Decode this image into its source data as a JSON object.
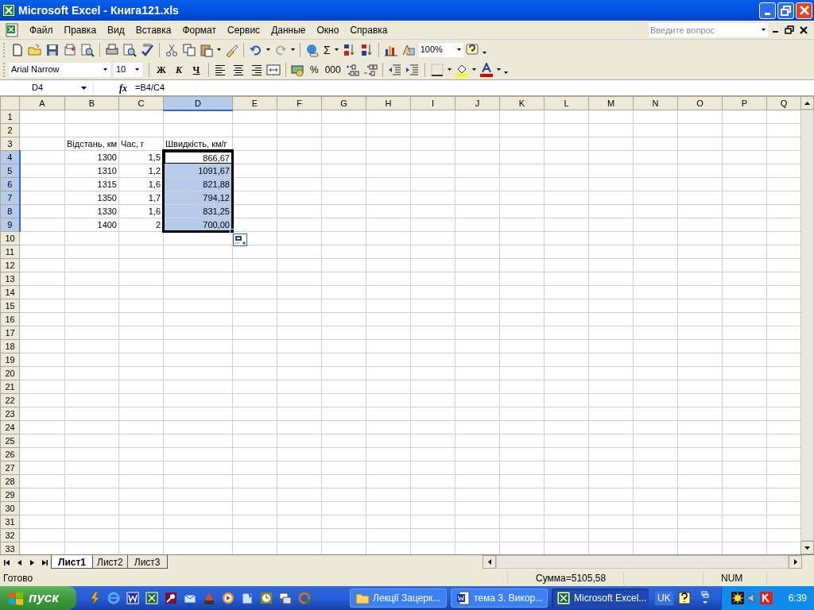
{
  "window": {
    "title": "Microsoft Excel - Книга121.xls"
  },
  "menu": [
    {
      "label": "Файл"
    },
    {
      "label": "Правка"
    },
    {
      "label": "Вид"
    },
    {
      "label": "Вставка"
    },
    {
      "label": "Формат"
    },
    {
      "label": "Сервис"
    },
    {
      "label": "Данные"
    },
    {
      "label": "Окно"
    },
    {
      "label": "Справка"
    }
  ],
  "help_box": {
    "placeholder": "Введите вопрос"
  },
  "standard_toolbar": {
    "autosum": "Σ",
    "zoom": "100%"
  },
  "formatting_toolbar": {
    "font": "Arial Narrow",
    "size": "10",
    "style_buttons": [
      "Ж",
      "К",
      "Ч"
    ],
    "number_buttons": [
      "%",
      "000"
    ]
  },
  "formula_bar": {
    "name_box": "D4",
    "function_label": "fx",
    "formula": "=B4/C4"
  },
  "columns": [
    {
      "label": "A",
      "selected": false
    },
    {
      "label": "B",
      "selected": false
    },
    {
      "label": "C",
      "selected": false
    },
    {
      "label": "D",
      "selected": true
    },
    {
      "label": "E",
      "selected": false
    },
    {
      "label": "F",
      "selected": false
    },
    {
      "label": "G",
      "selected": false
    },
    {
      "label": "H",
      "selected": false
    },
    {
      "label": "I",
      "selected": false
    },
    {
      "label": "J",
      "selected": false
    },
    {
      "label": "K",
      "selected": false
    },
    {
      "label": "L",
      "selected": false
    },
    {
      "label": "M",
      "selected": false
    },
    {
      "label": "N",
      "selected": false
    },
    {
      "label": "O",
      "selected": false
    },
    {
      "label": "P",
      "selected": false
    },
    {
      "label": "Q",
      "selected": false
    }
  ],
  "rows": [
    {
      "label": "1",
      "selected": false
    },
    {
      "label": "2",
      "selected": false
    },
    {
      "label": "3",
      "selected": false,
      "column_b": "Відстань, км",
      "column_c": "Час, г",
      "column_d": {
        "text": "Швидкість, км/г",
        "selected": false,
        "active": false
      }
    },
    {
      "label": "4",
      "selected": true,
      "column_b": "1300",
      "column_c": "1,5",
      "column_d": {
        "text": "866,67",
        "selected": true,
        "active": true
      }
    },
    {
      "label": "5",
      "selected": true,
      "column_b": "1310",
      "column_c": "1,2",
      "column_d": {
        "text": "1091,67",
        "selected": true,
        "active": false
      }
    },
    {
      "label": "6",
      "selected": true,
      "column_b": "1315",
      "column_c": "1,6",
      "column_d": {
        "text": "821,88",
        "selected": true,
        "active": false
      }
    },
    {
      "label": "7",
      "selected": true,
      "column_b": "1350",
      "column_c": "1,7",
      "column_d": {
        "text": "794,12",
        "selected": true,
        "active": false
      }
    },
    {
      "label": "8",
      "selected": true,
      "column_b": "1330",
      "column_c": "1,6",
      "column_d": {
        "text": "831,25",
        "selected": true,
        "active": false
      }
    },
    {
      "label": "9",
      "selected": true,
      "column_b": "1400",
      "column_c": "2",
      "column_d": {
        "text": "700,00",
        "selected": true,
        "active": false
      }
    },
    {
      "label": "10",
      "selected": false
    },
    {
      "label": "11",
      "selected": false
    },
    {
      "label": "12",
      "selected": false
    },
    {
      "label": "13",
      "selected": false
    },
    {
      "label": "14",
      "selected": false
    },
    {
      "label": "15",
      "selected": false
    },
    {
      "label": "16",
      "selected": false
    },
    {
      "label": "17",
      "selected": false
    },
    {
      "label": "18",
      "selected": false
    },
    {
      "label": "19",
      "selected": false
    },
    {
      "label": "20",
      "selected": false
    },
    {
      "label": "21",
      "selected": false
    },
    {
      "label": "22",
      "selected": false
    },
    {
      "label": "23",
      "selected": false
    },
    {
      "label": "24",
      "selected": false
    },
    {
      "label": "25",
      "selected": false
    },
    {
      "label": "26",
      "selected": false
    },
    {
      "label": "27",
      "selected": false
    },
    {
      "label": "28",
      "selected": false
    },
    {
      "label": "29",
      "selected": false
    },
    {
      "label": "30",
      "selected": false
    },
    {
      "label": "31",
      "selected": false
    },
    {
      "label": "32",
      "selected": false
    },
    {
      "label": "33",
      "selected": false
    }
  ],
  "sheet_tabs": [
    {
      "label": "Лист1",
      "selected": true
    },
    {
      "label": "Лист2",
      "selected": false
    },
    {
      "label": "Лист3",
      "selected": false
    }
  ],
  "status_bar": {
    "status": "Готово",
    "sum": "Сумма=5105,58",
    "num": "NUM"
  },
  "taskbar": {
    "start": "пуск",
    "tasks": [
      {
        "label": "Лекції Зацерк...",
        "kind": "folder",
        "selected": false
      },
      {
        "label": "тема 3. Викор...",
        "kind": "word",
        "selected": false
      },
      {
        "label": "Microsoft Excel...",
        "kind": "excel",
        "selected": true
      }
    ],
    "language": "UK",
    "clock": "6:39"
  }
}
